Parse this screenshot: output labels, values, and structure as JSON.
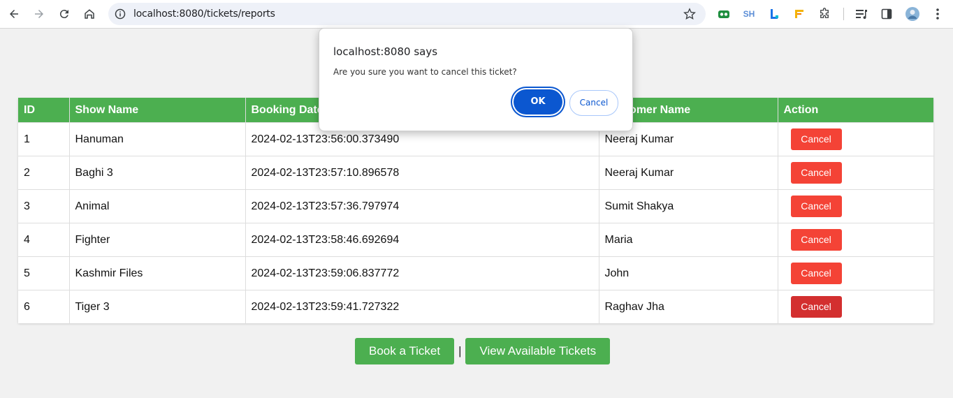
{
  "browser": {
    "url": "localhost:8080/tickets/reports",
    "extensions": [
      "ext-green-icon",
      "SH",
      "ext-l-icon",
      "ext-flag-icon",
      "puzzle-icon"
    ]
  },
  "table": {
    "headers": [
      "ID",
      "Show Name",
      "Booking Date",
      "Customer Name",
      "Action"
    ],
    "rows": [
      {
        "id": "1",
        "show": "Hanuman",
        "date": "2024-02-13T23:56:00.373490",
        "customer": "Neeraj Kumar",
        "action": "Cancel"
      },
      {
        "id": "2",
        "show": "Baghi 3",
        "date": "2024-02-13T23:57:10.896578",
        "customer": "Neeraj Kumar",
        "action": "Cancel"
      },
      {
        "id": "3",
        "show": "Animal",
        "date": "2024-02-13T23:57:36.797974",
        "customer": "Sumit Shakya",
        "action": "Cancel"
      },
      {
        "id": "4",
        "show": "Fighter",
        "date": "2024-02-13T23:58:46.692694",
        "customer": "Maria",
        "action": "Cancel"
      },
      {
        "id": "5",
        "show": "Kashmir Files",
        "date": "2024-02-13T23:59:06.837772",
        "customer": "John",
        "action": "Cancel"
      },
      {
        "id": "6",
        "show": "Tiger 3",
        "date": "2024-02-13T23:59:41.727322",
        "customer": "Raghav Jha",
        "action": "Cancel"
      }
    ]
  },
  "bottom": {
    "book_label": "Book a Ticket",
    "separator": "|",
    "view_label": "View Available Tickets"
  },
  "dialog": {
    "title": "localhost:8080 says",
    "message": "Are you sure you want to cancel this ticket?",
    "ok_label": "OK",
    "cancel_label": "Cancel"
  },
  "colors": {
    "header_green": "#4caf50",
    "cancel_red": "#f44336",
    "dialog_blue": "#0b57d0"
  }
}
